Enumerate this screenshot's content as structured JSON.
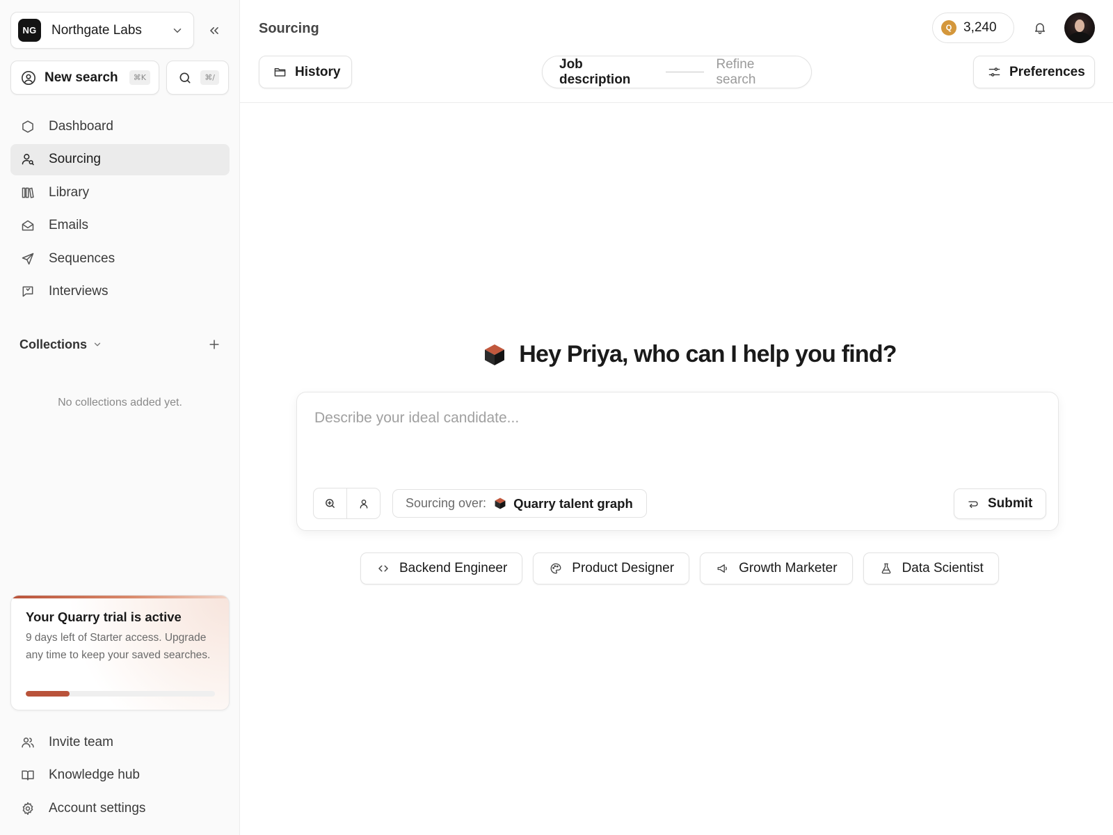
{
  "org": {
    "initials": "NG",
    "name": "Northgate Labs"
  },
  "sidebar": {
    "new_search_label": "New search",
    "new_search_shortcut": "⌘K",
    "search_shortcut": "⌘/",
    "nav": [
      {
        "label": "Dashboard",
        "icon": "hexagon-icon",
        "active": false
      },
      {
        "label": "Sourcing",
        "icon": "user-search-icon",
        "active": true
      },
      {
        "label": "Library",
        "icon": "library-icon",
        "active": false
      },
      {
        "label": "Emails",
        "icon": "mail-open-icon",
        "active": false
      },
      {
        "label": "Sequences",
        "icon": "send-icon",
        "active": false
      },
      {
        "label": "Interviews",
        "icon": "message-square-icon",
        "active": false
      }
    ],
    "collections": {
      "title": "Collections",
      "empty_text": "No collections added yet."
    },
    "trial": {
      "title": "Your Quarry trial is active",
      "body": "9 days left of Starter access. Upgrade any time to keep your saved searches.",
      "progress_fraction": 0.23
    },
    "footer": [
      {
        "label": "Invite team",
        "icon": "users-icon"
      },
      {
        "label": "Knowledge hub",
        "icon": "book-open-icon"
      },
      {
        "label": "Account settings",
        "icon": "gear-icon"
      }
    ]
  },
  "header": {
    "title": "Sourcing",
    "credits": "3,240",
    "coin_letter": "Q"
  },
  "toolbar": {
    "history_label": "History",
    "preferences_label": "Preferences",
    "steps": {
      "active": "Job description",
      "next": "Refine search"
    }
  },
  "main": {
    "greeting": "Hey Priya, who can I help you find?",
    "composer": {
      "placeholder": "Describe your ideal candidate...",
      "value": "",
      "source_prefix": "Sourcing over:",
      "source_value": "Quarry talent graph",
      "submit_label": "Submit"
    },
    "suggestions": [
      {
        "label": "Backend Engineer",
        "icon": "code-icon"
      },
      {
        "label": "Product Designer",
        "icon": "palette-icon"
      },
      {
        "label": "Growth Marketer",
        "icon": "megaphone-icon"
      },
      {
        "label": "Data Scientist",
        "icon": "flask-icon"
      }
    ]
  },
  "colors": {
    "accent": "#b9533a",
    "coin": "#d4973b",
    "active_nav_bg": "#ebebeb"
  }
}
